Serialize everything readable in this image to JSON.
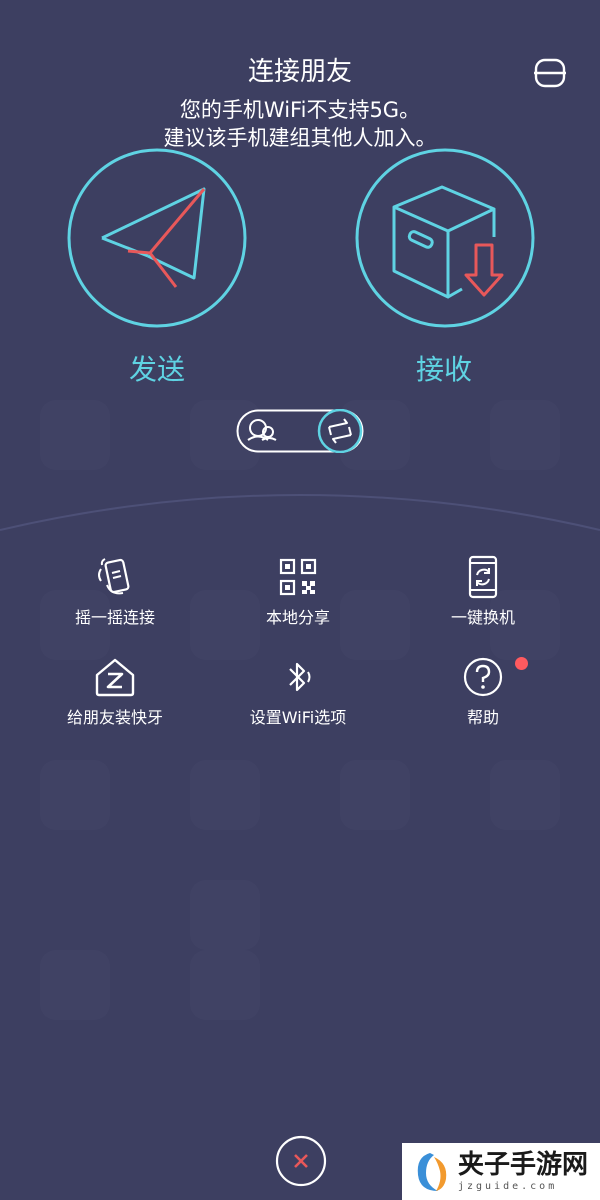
{
  "header": {
    "title": "连接朋友",
    "notice_line1": "您的手机WiFi不支持5G。",
    "notice_line2": "建议该手机建组其他人加入。",
    "menu_icon": "menu-icon"
  },
  "actions": {
    "send_label": "发送",
    "receive_label": "接收",
    "send_icon": "paper-plane-icon",
    "receive_icon": "box-download-icon"
  },
  "mode_toggle": {
    "left_icon": "people-icon",
    "right_icon": "swap-arrows-icon",
    "active": "right"
  },
  "tools": [
    {
      "label": "摇一摇连接",
      "icon": "shake-phone-icon"
    },
    {
      "label": "本地分享",
      "icon": "qr-code-icon"
    },
    {
      "label": "一键换机",
      "icon": "phone-sync-icon"
    },
    {
      "label": "给朋友装快牙",
      "icon": "house-z-icon"
    },
    {
      "label": "设置WiFi选项",
      "icon": "bluetooth-icon"
    },
    {
      "label": "帮助",
      "icon": "help-icon",
      "badge": true
    }
  ],
  "footer": {
    "close_icon": "close-icon"
  },
  "watermark": {
    "title": "夹子手游网",
    "subtitle": "jzguide.com"
  },
  "colors": {
    "background": "#3d3f61",
    "accent_cyan": "#5fd3e3",
    "accent_red": "#e8585a",
    "badge_red": "#ff5a5f"
  }
}
